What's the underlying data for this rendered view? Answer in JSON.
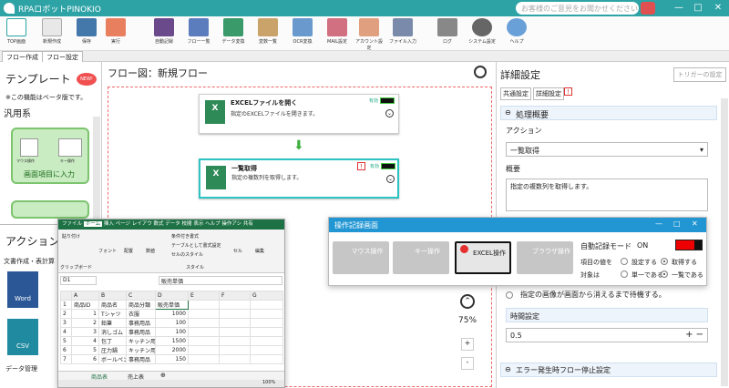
{
  "app": {
    "title": "RPAロボットPINOKIO",
    "feedback_placeholder": "お客様のご意見をお聞かせください"
  },
  "ribbon": [
    "TOP画面",
    "新規作成",
    "保存",
    "実行",
    "自動記録",
    "フロー一覧",
    "データ変換",
    "変数一覧",
    "OCR変換",
    "MAIL設定",
    "アカウント設定",
    "ファイル入力",
    "ログ",
    "システム設定",
    "ヘルプ"
  ],
  "tabs": [
    "フロー作成",
    "フロー設定"
  ],
  "left": {
    "template_title": "テンプレート",
    "new_badge": "NEW!",
    "beta_note": "※この機能はベータ版です。",
    "category": "汎用系",
    "card1": "画面項目に入力",
    "card1_icon1": "マウス操作",
    "card1_icon2": "キー操作",
    "action_title": "アクション",
    "doc_label": "文書作成・表計算",
    "apps": [
      "Word",
      "CSV"
    ],
    "data_mgmt": "データ管理"
  },
  "flow": {
    "header": "フロー図：新規フロー",
    "zoom": "75%",
    "plus": "+",
    "minus": "-",
    "nodes": [
      {
        "title": "EXCELファイルを開く",
        "desc": "指定のEXCELファイルを開きます。",
        "status": "有効",
        "icon": "X",
        "icon_sub": "Excel"
      },
      {
        "title": "一覧取得",
        "desc": "指定の複数列を取得します。",
        "status": "有効",
        "icon": "X",
        "icon_sub": "Excel"
      }
    ]
  },
  "detail": {
    "title": "詳細設定",
    "trigger_btn": "トリガーの設定",
    "tabs": [
      "共通設定",
      "詳細設定"
    ],
    "section1": "処理概要",
    "action_label": "アクション",
    "action_value": "一覧取得",
    "summary_label": "概要",
    "summary_value": "指定の複数列を取得します。",
    "wait_option": "指定の画像が画面から消えるまで待機する。",
    "time_label": "時間設定",
    "time_value": "0.5",
    "section2": "エラー発生時フロー停止設定"
  },
  "excel": {
    "tabs": [
      "ファイル",
      "ホーム",
      "挿入",
      "ページ レイアウ",
      "数式",
      "データ",
      "校閲",
      "表示",
      "ヘルプ",
      "操作アシ",
      "共有"
    ],
    "groups": [
      "貼り付け",
      "クリップボード",
      "フォント",
      "配置",
      "数値",
      "条件付き書式",
      "テーブルとして書式設定",
      "セルのスタイル",
      "スタイル",
      "セル",
      "編集"
    ],
    "cellref": "D1",
    "formula": "販売単価",
    "cols": [
      "",
      "A",
      "B",
      "C",
      "D",
      "E",
      "F",
      "G"
    ],
    "rows": [
      [
        "1",
        "商品ID",
        "商品名",
        "商品分類",
        "販売単価",
        "",
        "",
        ""
      ],
      [
        "2",
        "1",
        "Tシャツ",
        "衣服",
        "1000",
        "",
        "",
        ""
      ],
      [
        "3",
        "2",
        "鉛筆",
        "事務用品",
        "100",
        "",
        "",
        ""
      ],
      [
        "4",
        "3",
        "消しゴム",
        "事務用品",
        "100",
        "",
        "",
        ""
      ],
      [
        "5",
        "4",
        "包丁",
        "キッチン用",
        "1500",
        "",
        "",
        ""
      ],
      [
        "6",
        "5",
        "圧力鍋",
        "キッチン用",
        "2000",
        "",
        "",
        ""
      ],
      [
        "7",
        "6",
        "ボールペン",
        "事務用品",
        "150",
        "",
        "",
        ""
      ]
    ],
    "sheets": [
      "商品表",
      "売上表"
    ],
    "zoom": "100%"
  },
  "recorder": {
    "title": "操作記録画面",
    "buttons": [
      "マウス操作",
      "キー操作",
      "EXCEL操作",
      "ブラウザ操作"
    ],
    "auto_label": "自動記録モード",
    "auto_value": "ON",
    "item_label": "項目の値を",
    "opt1": "設定する",
    "opt2": "取得する",
    "target_label": "対象は",
    "opt3": "単一である",
    "opt4": "一覧である"
  },
  "colors": {
    "accent": "#2ea3a6",
    "excel": "#1e7145",
    "rec": "#2196d3"
  }
}
